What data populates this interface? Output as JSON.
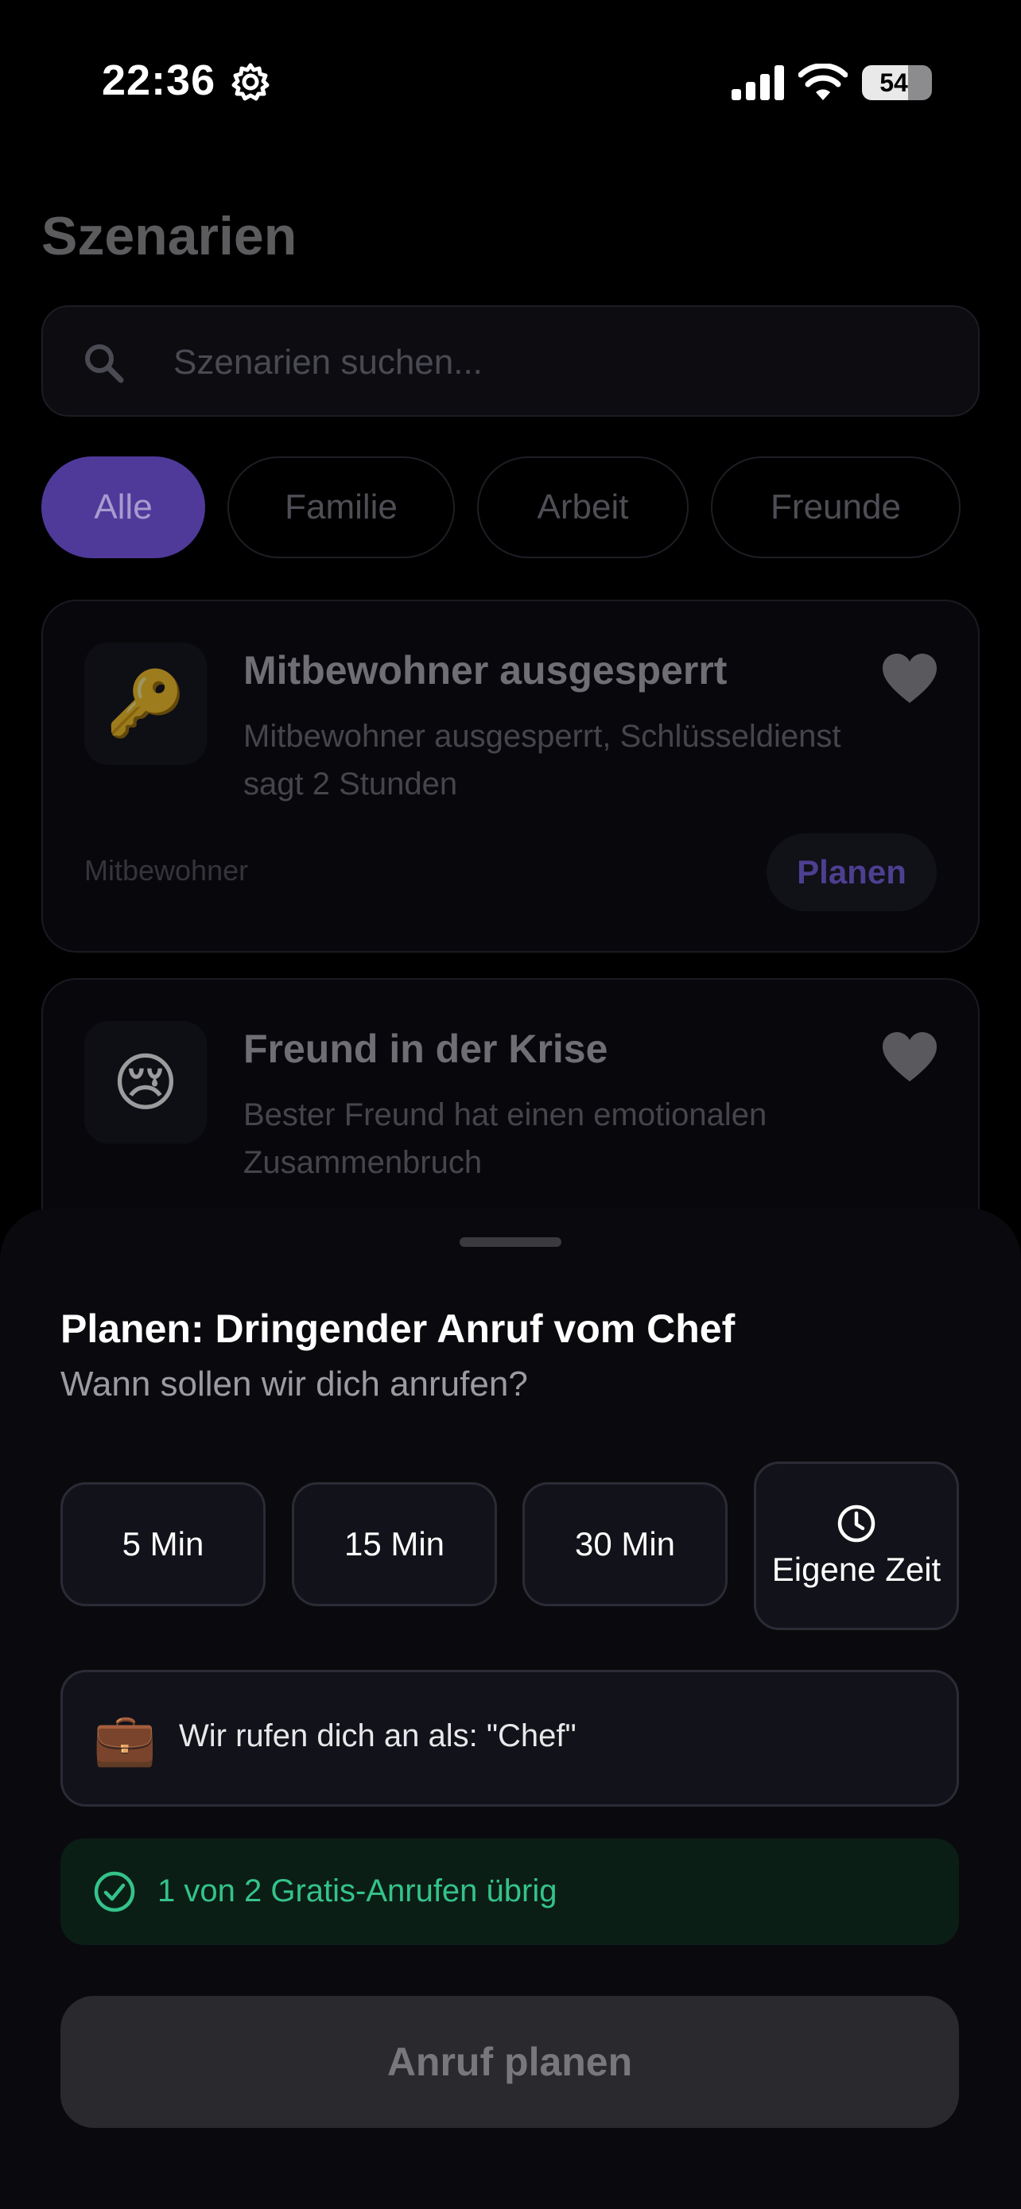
{
  "status_bar": {
    "time": "22:36",
    "battery": "54"
  },
  "background": {
    "title": "Szenarien",
    "search": {
      "placeholder": "Szenarien suchen..."
    },
    "chips": [
      {
        "label": "Alle",
        "active": true
      },
      {
        "label": "Familie",
        "active": false
      },
      {
        "label": "Arbeit",
        "active": false
      },
      {
        "label": "Freunde",
        "active": false
      }
    ],
    "cards": [
      {
        "emoji": "🔑",
        "title": "Mitbewohner ausgesperrt",
        "description": "Mitbewohner ausgesperrt, Schlüsseldienst sagt 2 Stunden",
        "tag": "Mitbewohner",
        "plan_label": "Planen"
      },
      {
        "emoji": "😢",
        "title": "Freund in der Krise",
        "description": "Bester Freund hat einen emotionalen Zusammenbruch"
      }
    ]
  },
  "sheet": {
    "title": "Planen: Dringender Anruf vom Chef",
    "subtitle": "Wann sollen wir dich anrufen?",
    "options": [
      {
        "label": "5 Min"
      },
      {
        "label": "15 Min"
      },
      {
        "label": "30 Min"
      },
      {
        "label": "Eigene Zeit",
        "icon": "clock-icon"
      }
    ],
    "caller": {
      "icon": "briefcase-icon",
      "emoji": "💼",
      "text": "Wir rufen dich an als: \"Chef\""
    },
    "free_calls": {
      "icon": "check-circle-icon",
      "text": "1 von 2 Gratis-Anrufen übrig"
    },
    "cta": "Anruf planen"
  },
  "colors": {
    "accent": "#5b45b0",
    "success": "#34c38a",
    "sheet_bg": "#0a0a0e"
  }
}
